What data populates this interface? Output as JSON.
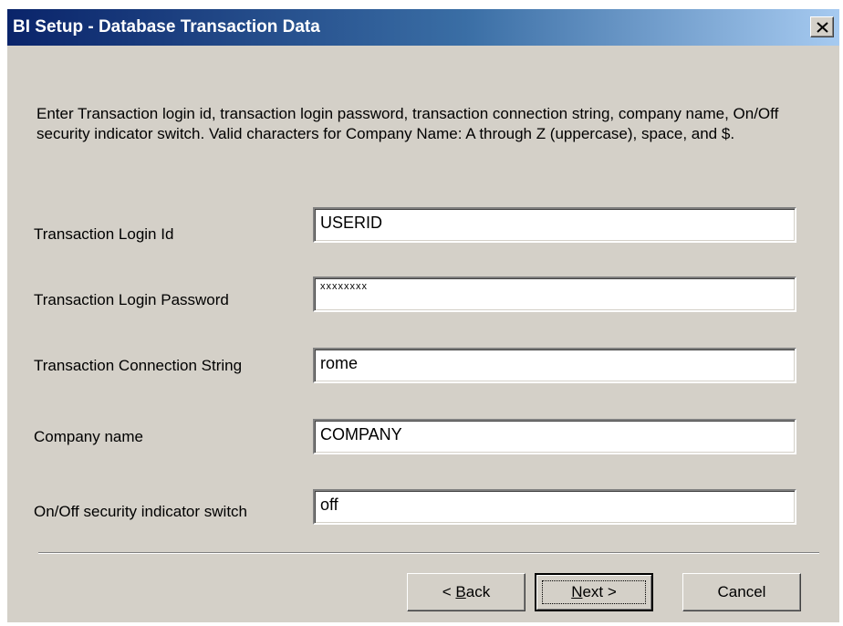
{
  "window": {
    "title": "BI Setup - Database Transaction Data",
    "close_glyph": "✕"
  },
  "intro": {
    "text": "Enter Transaction login id, transaction login password, transaction connection string, company name, On/Off security indicator switch.  Valid characters for Company Name: A through Z (uppercase), space, and $."
  },
  "fields": [
    {
      "label": "Transaction Login Id",
      "value": "USERID"
    },
    {
      "label": "Transaction Login Password",
      "value": "xxxxxxxx"
    },
    {
      "label": "Transaction Connection String",
      "value": "rome"
    },
    {
      "label": "Company name",
      "value": "COMPANY"
    },
    {
      "label": "On/Off security indicator switch",
      "value": "off"
    }
  ],
  "buttons": {
    "back": {
      "prefix": "< ",
      "mnemonic": "B",
      "rest": "ack"
    },
    "next": {
      "mnemonic": "N",
      "rest": "ext >"
    },
    "cancel": {
      "label": "Cancel"
    }
  },
  "colors": {
    "title_gradient_start": "#0a246a",
    "title_gradient_end": "#a6caf0",
    "dialog_face": "#d4d0c8"
  },
  "icons": {
    "close": "close-icon"
  }
}
